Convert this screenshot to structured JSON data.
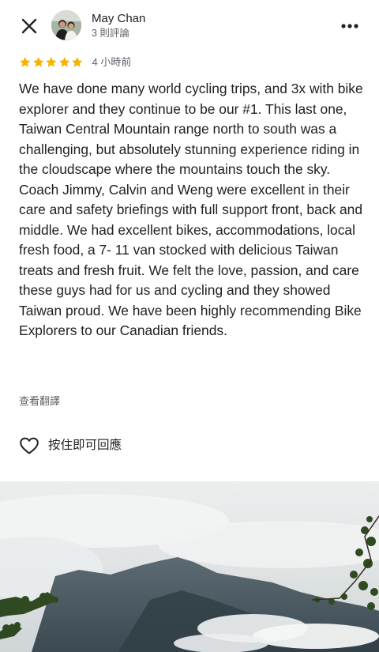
{
  "header": {
    "close_icon": "close-icon",
    "author_name": "May Chan",
    "review_count": "3 則評論",
    "more_icon": "more-horizontal-icon"
  },
  "review": {
    "rating": 5,
    "rating_max": 5,
    "star_color": "#f4b400",
    "time": "4 小時前",
    "text": "We have done many world cycling trips, and 3x with bike explorer and they continue to be our #1. This last one, Taiwan Central Mountain range north to south was a challenging, but absolutely stunning experience riding in the cloudscape where the mountains touch the sky. Coach Jimmy, Calvin and Weng were excellent in their care and safety briefings with full support front, back and middle. We had excellent bikes, accommodations, local fresh food, a 7- 11 van stocked with delicious Taiwan treats and fresh fruit. We felt the love, passion, and care these guys had for us and cycling and they showed Taiwan proud. We have been highly recommending Bike Explorers to our Canadian friends.",
    "translate_label": "查看翻譯"
  },
  "actions": {
    "like_icon": "heart-outline-icon",
    "like_label": "按住即可回應"
  },
  "photo": {
    "subject": "misty mountain ridge with clouds and tree branches"
  }
}
